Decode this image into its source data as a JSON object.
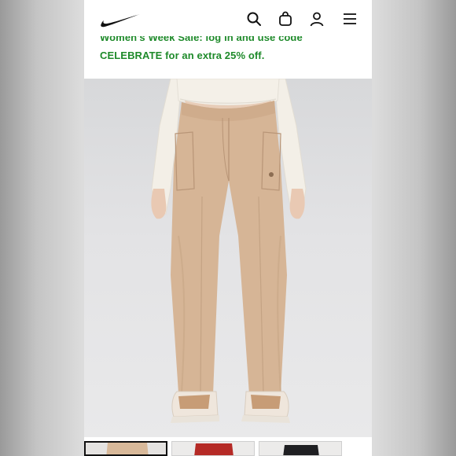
{
  "header": {
    "logo_icon": "nike-swoosh-logo",
    "icons": [
      "search-icon",
      "bag-icon",
      "account-icon",
      "menu-icon"
    ]
  },
  "promo": {
    "line1": "Women's Week Sale: log in and use code",
    "line2": "CELEBRATE for an extra 25% off."
  },
  "hero": {
    "image": "product-photo-khaki-pants",
    "colors": {
      "pants": "#d6b596",
      "top": "#f4f0e8",
      "background": "#e2e2e4"
    }
  },
  "thumbnails": [
    {
      "name": "thumbnail-khaki",
      "color": "#d8b99a",
      "selected": true
    },
    {
      "name": "thumbnail-red",
      "color": "#b52a26",
      "selected": false
    },
    {
      "name": "thumbnail-black",
      "color": "#1f1f22",
      "selected": false
    }
  ],
  "colors": {
    "promo_text": "#1e8a2a",
    "header_bg": "#ffffff",
    "icon": "#111111"
  }
}
